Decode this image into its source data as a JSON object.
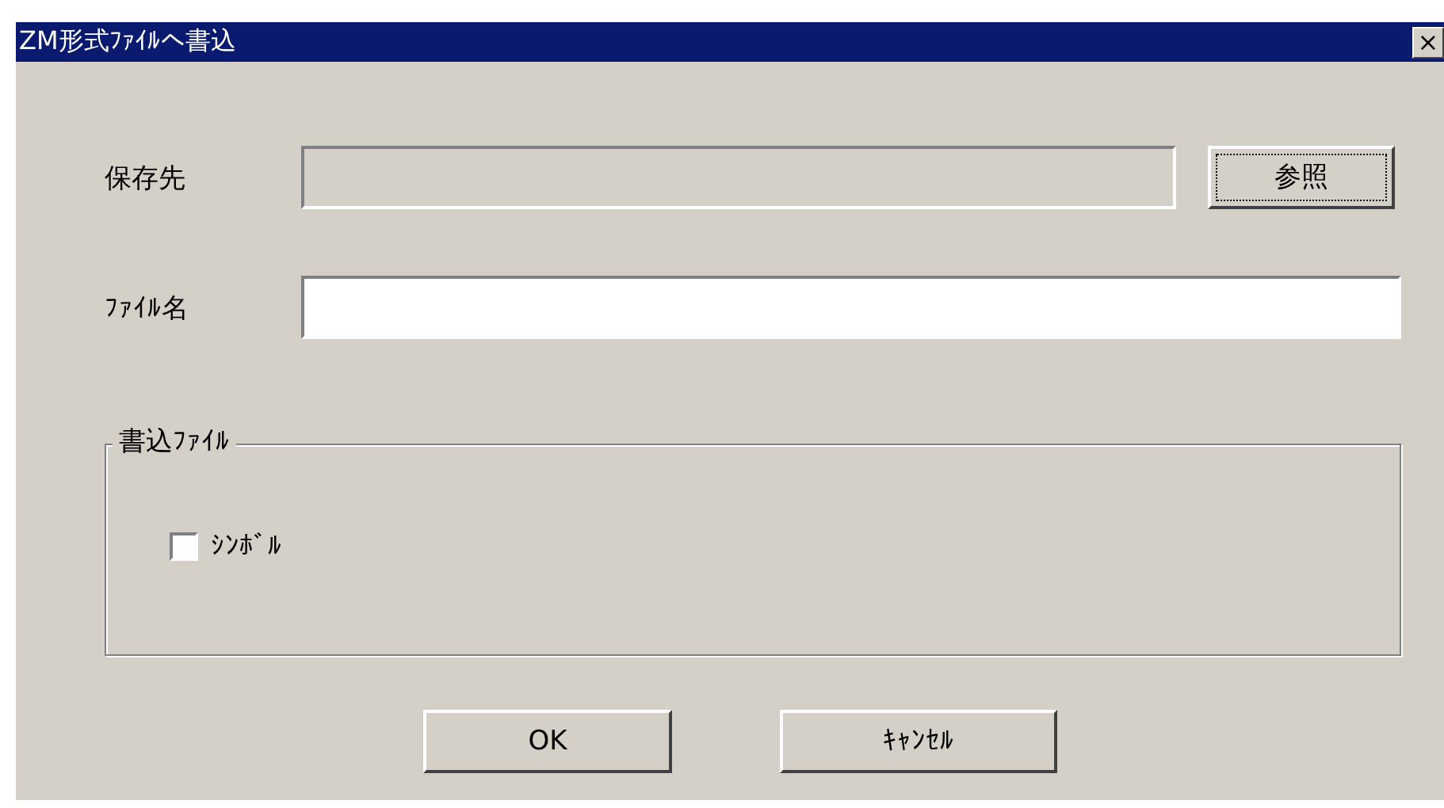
{
  "window": {
    "title": "ZM形式ﾌｧｲﾙへ書込",
    "close": "×"
  },
  "save_location": {
    "label": "保存先",
    "disabled": true,
    "browse_button": {
      "label": "参照",
      "focused": true
    }
  },
  "file_name": {
    "label": "ﾌｧｲﾙ名",
    "disabled": false
  },
  "write_files": {
    "legend": "書込ﾌｧｲﾙ",
    "options": [
      {
        "label": "ｼﾝﾎﾞﾙ",
        "checked": false
      }
    ]
  },
  "buttons": [
    {
      "label": "OK"
    },
    {
      "label": "ｷｬﾝｾﾙ"
    }
  ]
}
